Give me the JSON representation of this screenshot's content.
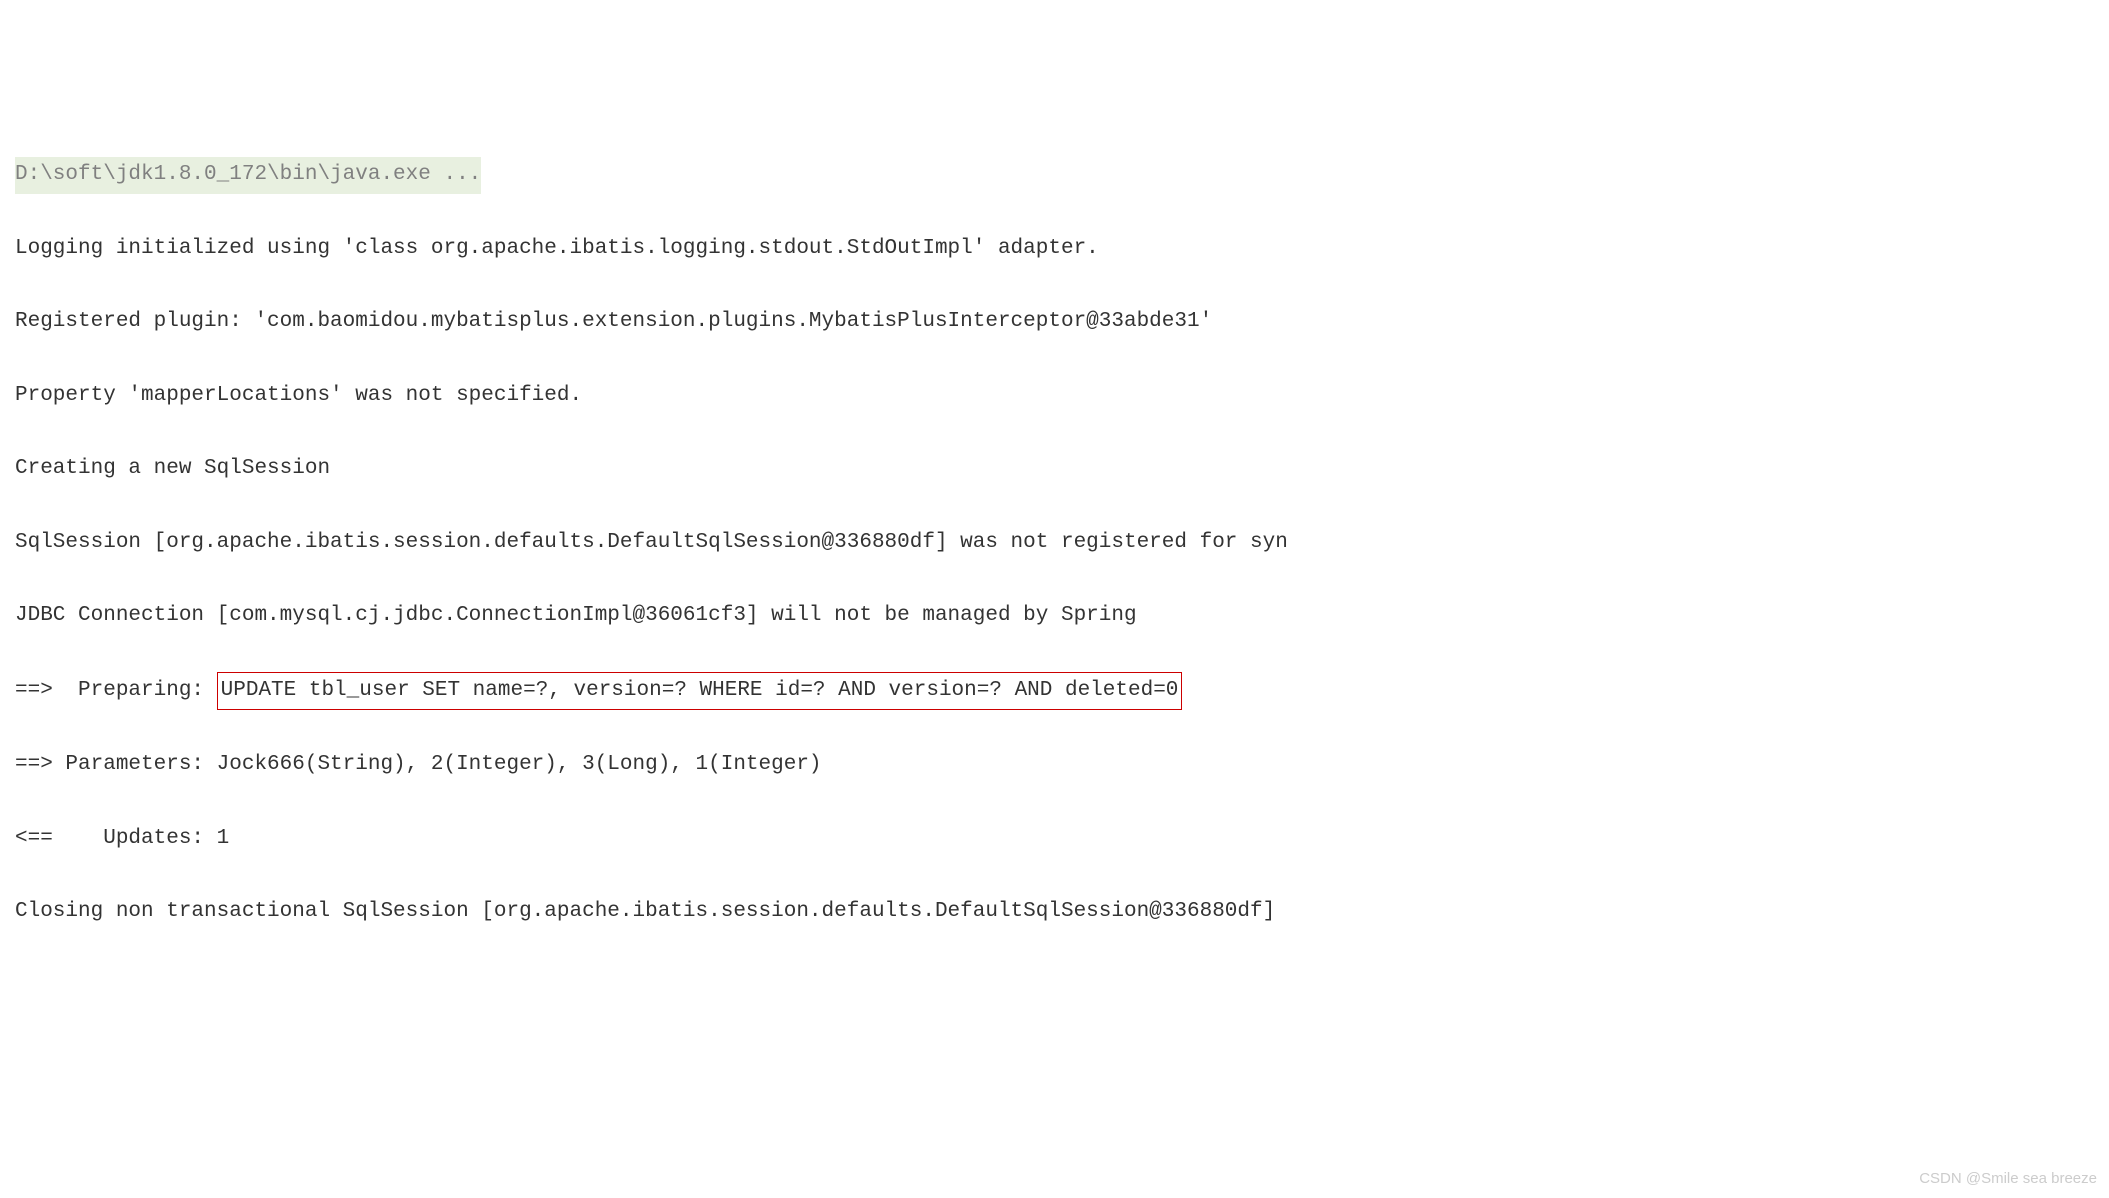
{
  "console": {
    "lines": {
      "cmd": "D:\\soft\\jdk1.8.0_172\\bin\\java.exe ...",
      "logging": "Logging initialized using 'class org.apache.ibatis.logging.stdout.StdOutImpl' adapter.",
      "plugin": "Registered plugin: 'com.baomidou.mybatisplus.extension.plugins.MybatisPlusInterceptor@33abde31'",
      "property": "Property 'mapperLocations' was not specified.",
      "creating": "Creating a new SqlSession",
      "session": "SqlSession [org.apache.ibatis.session.defaults.DefaultSqlSession@336880df] was not registered for syn",
      "jdbc": "JDBC Connection [com.mysql.cj.jdbc.ConnectionImpl@36061cf3] will not be managed by Spring",
      "preparing_prefix": "==>  Preparing: ",
      "preparing_sql": "UPDATE tbl_user SET name=?, version=? WHERE id=? AND version=? AND deleted=0",
      "parameters": "==> Parameters: Jock666(String), 2(Integer), 3(Long), 1(Integer)",
      "updates": "<==    Updates: 1",
      "closing": "Closing non transactional SqlSession [org.apache.ibatis.session.defaults.DefaultSqlSession@336880df]"
    }
  },
  "watermark": "CSDN @Smile sea breeze"
}
